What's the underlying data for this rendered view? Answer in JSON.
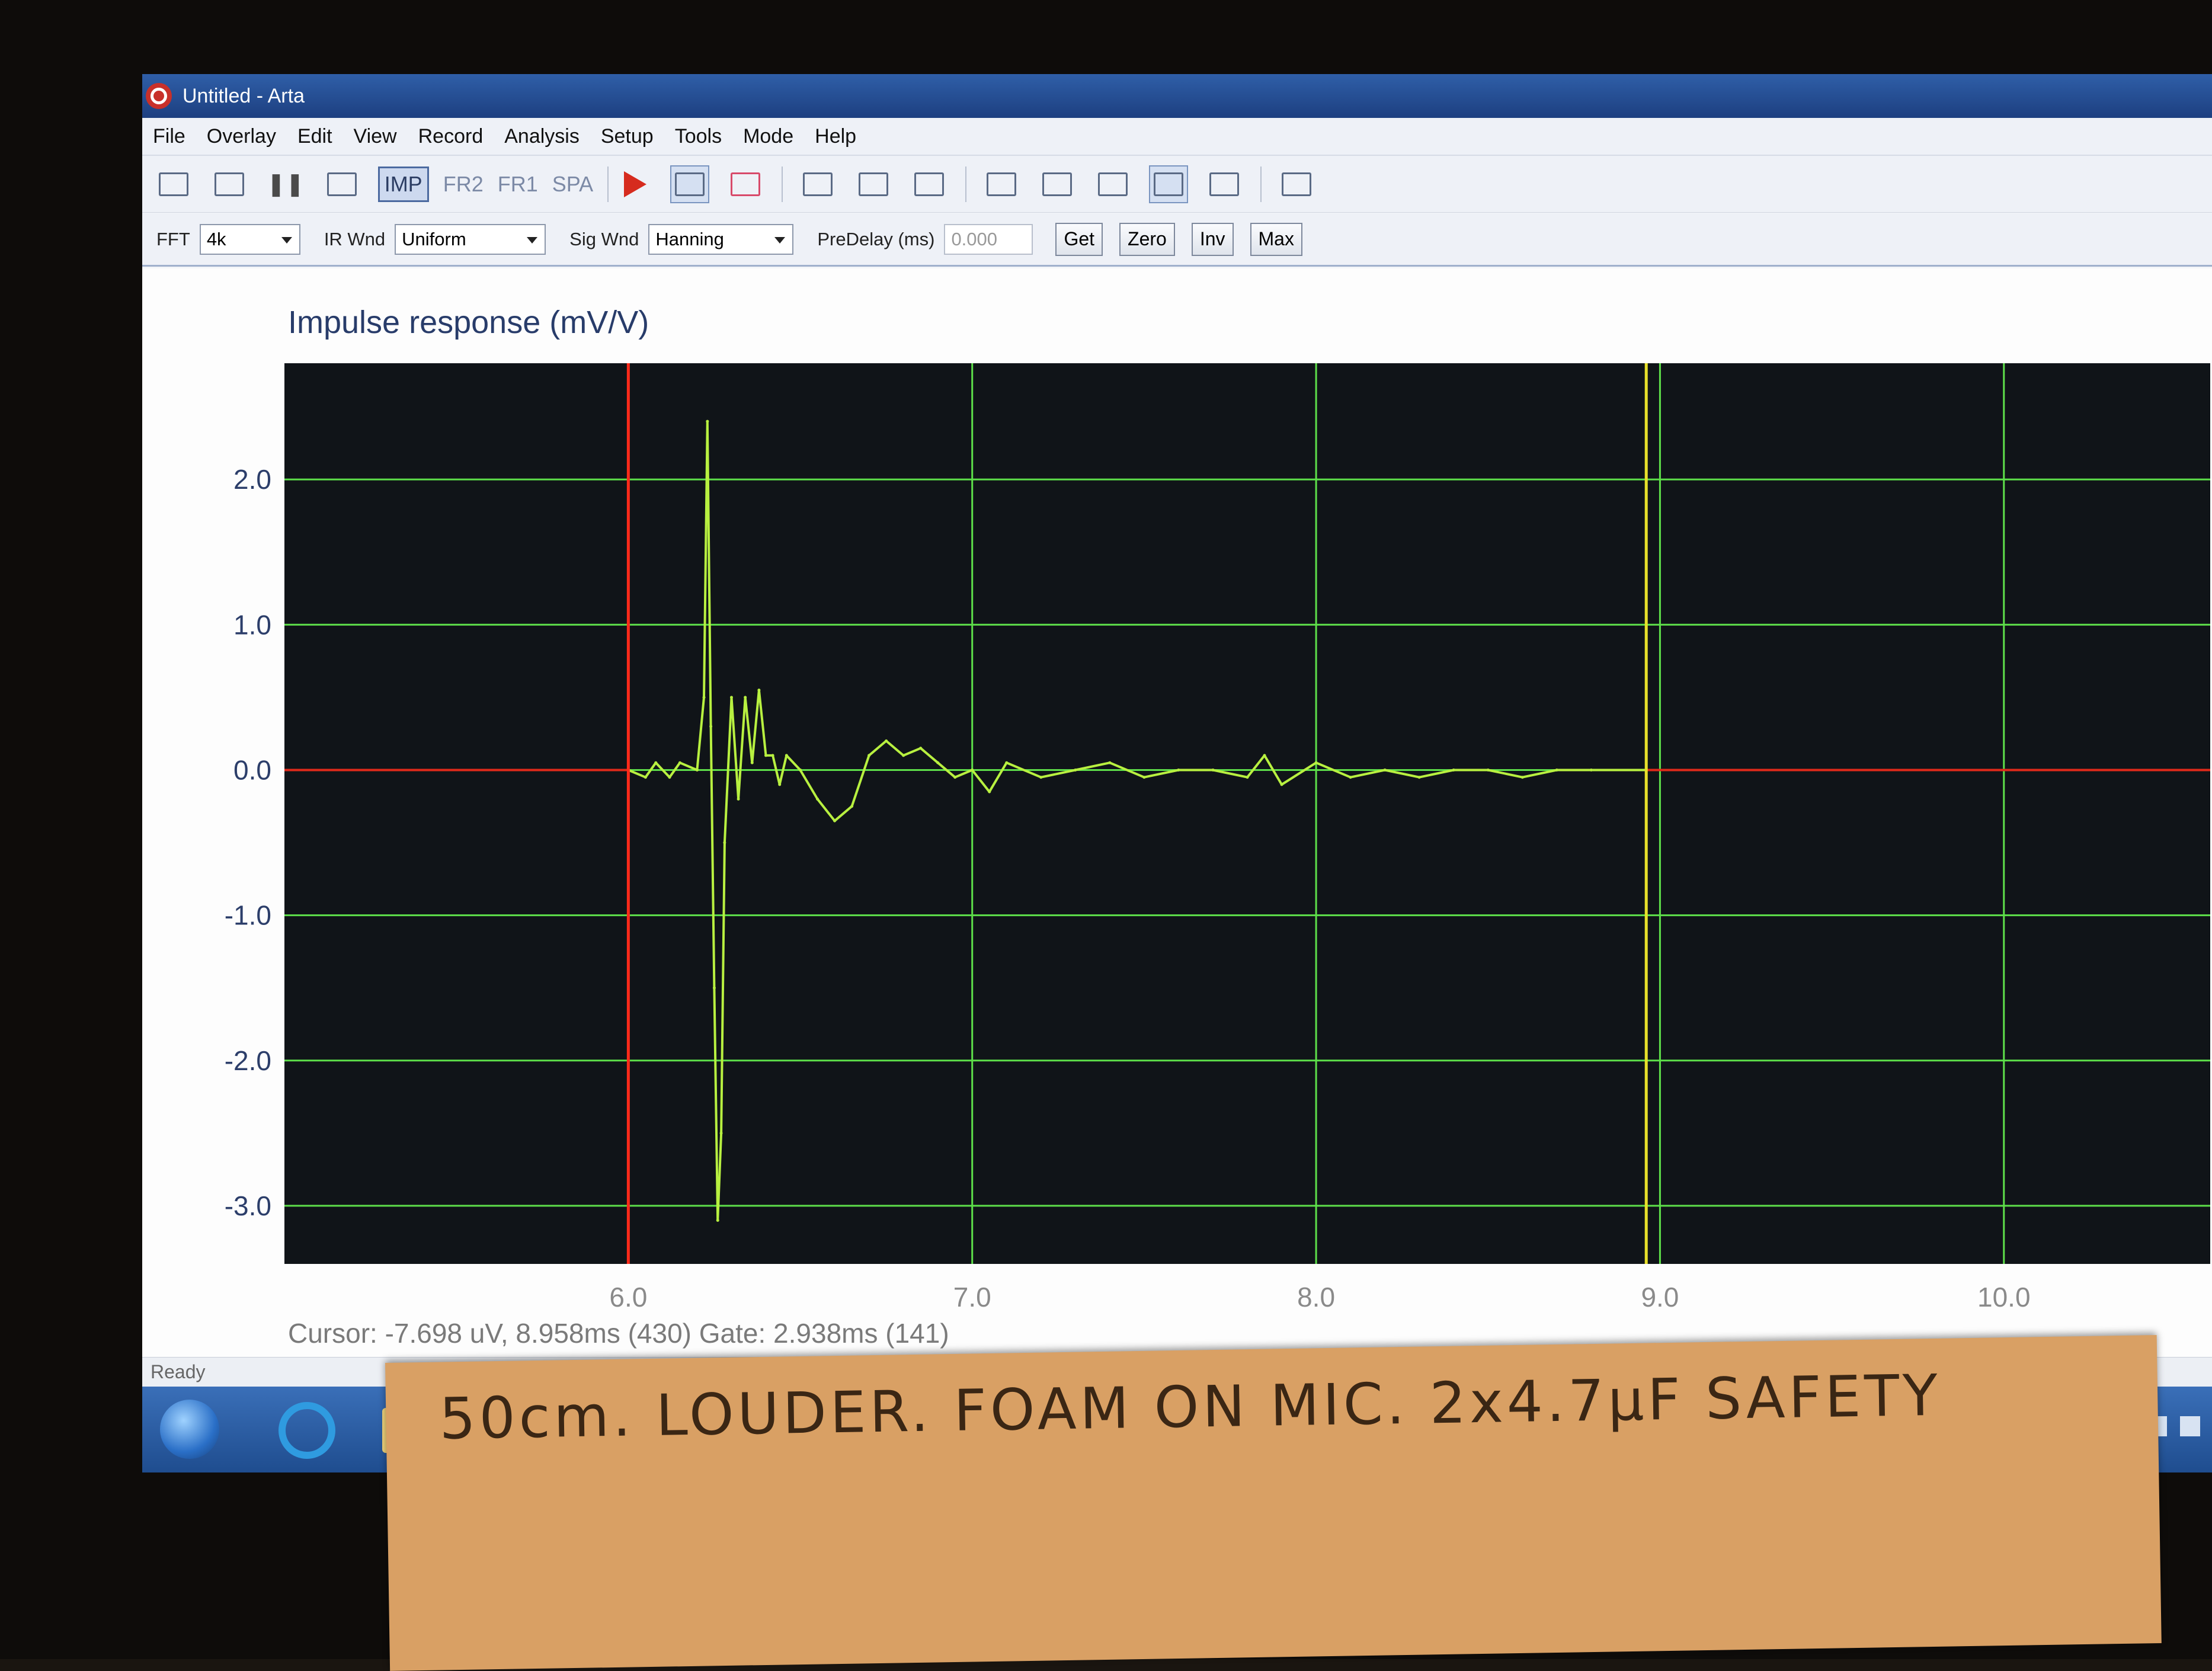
{
  "window": {
    "title": "Untitled - Arta"
  },
  "menu": [
    "File",
    "Overlay",
    "Edit",
    "View",
    "Record",
    "Analysis",
    "Setup",
    "Tools",
    "Mode",
    "Help"
  ],
  "toolbar": {
    "modes": [
      "IMP",
      "FR2",
      "FR1",
      "SPA"
    ],
    "selected_mode": "IMP"
  },
  "options": {
    "fft_label": "FFT",
    "fft_value": "4k",
    "ir_wnd_label": "IR Wnd",
    "ir_wnd_value": "Uniform",
    "sig_wnd_label": "Sig Wnd",
    "sig_wnd_value": "Hanning",
    "predelay_label": "PreDelay (ms)",
    "predelay_value": "0.000",
    "buttons": [
      "Get",
      "Zero",
      "Inv",
      "Max"
    ]
  },
  "chart_data": {
    "type": "line",
    "title": "Impulse response (mV/V)",
    "xlabel": "",
    "ylabel": "",
    "xlim": [
      5.0,
      10.6
    ],
    "ylim": [
      -3.4,
      2.8
    ],
    "xticks": [
      "6.0",
      "7.0",
      "8.0",
      "9.0",
      "10.0"
    ],
    "yticks": [
      "2.0",
      "1.0",
      "0.0",
      "-1.0",
      "-2.0",
      "-3.0"
    ],
    "grid": true,
    "background": "#101418",
    "colors": {
      "grid": "#5ee04a",
      "trace": "#b8f040",
      "outside": "#e02a1a",
      "gate_start": "#ff2a1a",
      "gate_end": "#e8e02a"
    },
    "gate": {
      "start_ms": 6.0,
      "end_ms": 8.96
    },
    "series": [
      {
        "x": [
          6.0,
          6.05,
          6.08,
          6.12,
          6.15,
          6.2,
          6.22,
          6.23,
          6.24,
          6.25,
          6.26,
          6.27,
          6.28,
          6.3,
          6.32,
          6.34,
          6.36,
          6.38,
          6.4,
          6.42,
          6.44,
          6.46,
          6.5,
          6.55,
          6.6,
          6.65,
          6.7,
          6.75,
          6.8,
          6.85,
          6.9,
          6.95,
          7.0,
          7.05,
          7.1,
          7.2,
          7.3,
          7.4,
          7.5,
          7.6,
          7.7,
          7.8,
          7.85,
          7.9,
          8.0,
          8.1,
          8.2,
          8.3,
          8.4,
          8.5,
          8.6,
          8.7,
          8.8,
          8.96
        ],
        "y": [
          0.0,
          -0.05,
          0.05,
          -0.05,
          0.05,
          0.0,
          0.5,
          2.4,
          0.3,
          -1.5,
          -3.1,
          -2.5,
          -0.5,
          0.5,
          -0.2,
          0.5,
          0.05,
          0.55,
          0.1,
          0.1,
          -0.1,
          0.1,
          0.0,
          -0.2,
          -0.35,
          -0.25,
          0.1,
          0.2,
          0.1,
          0.15,
          0.05,
          -0.05,
          0.0,
          -0.15,
          0.05,
          -0.05,
          0.0,
          0.05,
          -0.05,
          0.0,
          0.0,
          -0.05,
          0.1,
          -0.1,
          0.05,
          -0.05,
          0.0,
          -0.05,
          0.0,
          0.0,
          -0.05,
          0.0,
          0.0,
          0.0
        ]
      }
    ]
  },
  "readout": {
    "text": "Cursor: -7.698 uV, 8.958ms (430)  Gate: 2.938ms (141)"
  },
  "status": {
    "text": "Ready"
  },
  "note": {
    "text": "50cm. LOUDER. FOAM ON MIC. 2x4.7µF SAFETY"
  }
}
